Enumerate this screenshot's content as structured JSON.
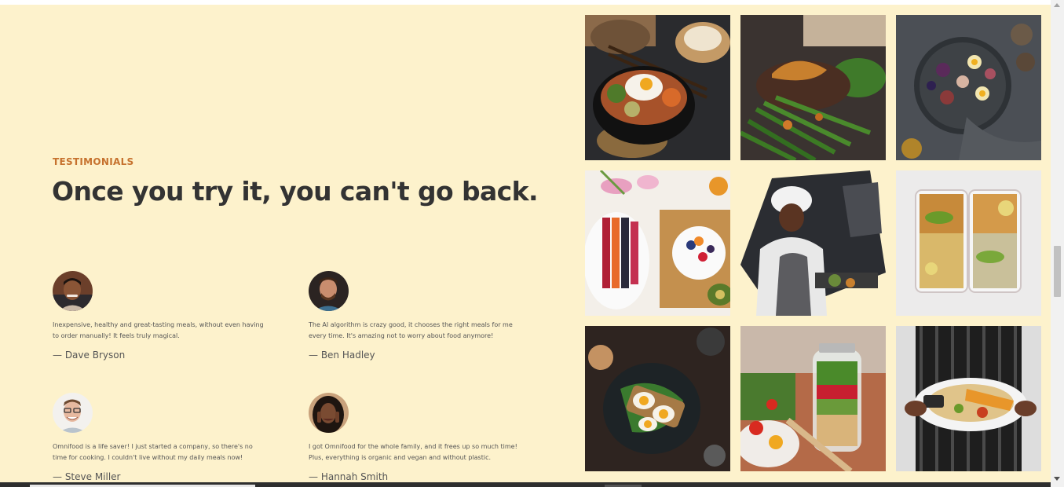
{
  "testimonials_section": {
    "subheading": "Testimonials",
    "heading": "Once you try it, you can't go back.",
    "items": [
      {
        "quote": "Inexpensive, healthy and great-tasting meals, without even having to order manually! It feels truly magical.",
        "name": "— Dave Bryson"
      },
      {
        "quote": "The AI algorithm is crazy good, it chooses the right meals for me every time. It's amazing not to worry about food anymore!",
        "name": "— Ben Hadley"
      },
      {
        "quote": "Omnifood is a life saver! I just started a company, so there's no time for cooking. I couldn't live without my daily meals now!",
        "name": "— Steve Miller"
      },
      {
        "quote": "I got Omnifood for the whole family, and it frees up so much time! Plus, everything is organic and vegan and without plastic.",
        "name": "— Hannah Smith"
      }
    ]
  },
  "gallery": {
    "images": [
      {
        "subject": "bibimbap-bowl-with-egg"
      },
      {
        "subject": "steak-with-green-beans"
      },
      {
        "subject": "fig-and-egg-salad-plate"
      },
      {
        "subject": "fruit-and-yogurt-breakfast"
      },
      {
        "subject": "chef-cooking"
      },
      {
        "subject": "chickpea-meal-prep-boxes"
      },
      {
        "subject": "egg-and-spinach-toast"
      },
      {
        "subject": "salad-in-jar"
      },
      {
        "subject": "waiter-serving-plate"
      }
    ]
  },
  "colors": {
    "background": "#fdf2cc",
    "accent": "#c6722e",
    "heading": "#333333"
  }
}
